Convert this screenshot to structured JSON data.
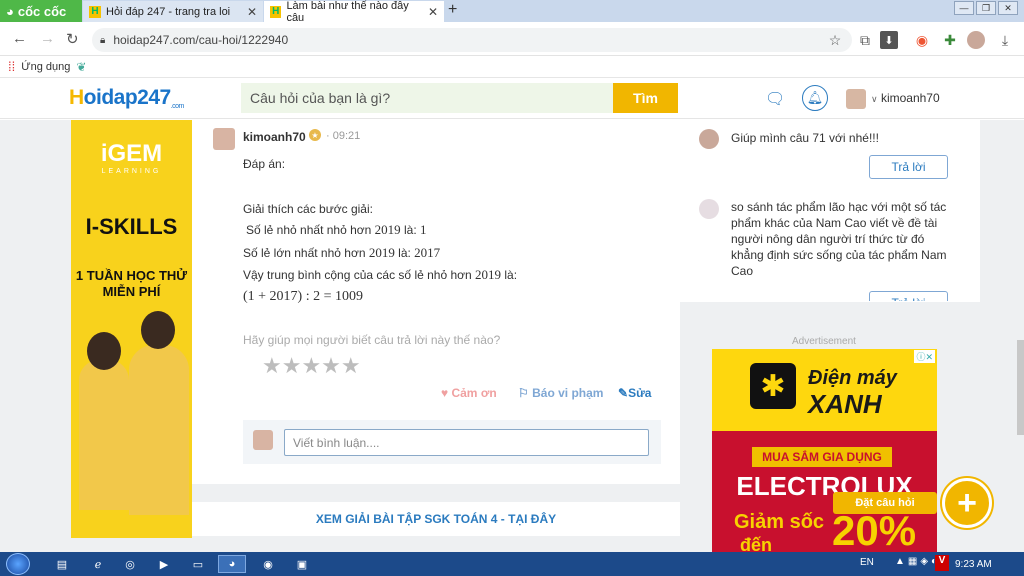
{
  "browser": {
    "brand": "cốc cốc",
    "tabs": [
      {
        "title": "Hỏi đáp 247 - trang tra loi"
      },
      {
        "title": "Làm bài như thế nào đây câu"
      }
    ],
    "url": "hoidap247.com/cau-hoi/1222940",
    "bookmarks": [
      {
        "label": "Ứng dụng"
      }
    ]
  },
  "site": {
    "logo_prefix": "H",
    "logo_rest": "oidap247",
    "logo_sub": ".com",
    "search_placeholder": "Câu hỏi của bạn là gì?",
    "search_button": "Tìm",
    "username": "kimoanh70"
  },
  "ad_left": {
    "brand": "iGEM",
    "brand_sub": "LEARNING",
    "headline": "I-SKILLS",
    "line1": "1 TUẦN HỌC THỬ",
    "line2": "MIỄN PHÍ"
  },
  "answer": {
    "user": "kimoanh70",
    "time": "· 09:21",
    "label": "Đáp án:",
    "explain_title": "Giải thích các bước giải:",
    "line1_text": "Số lẻ nhỏ nhất nhỏ hơn ",
    "line1_num": "2019",
    "line1_tail": " là: ",
    "line1_val": "1",
    "line2_text": "Số lẻ lớn nhất nhỏ hơn ",
    "line2_num": "2019",
    "line2_tail": " là: ",
    "line2_val": "2017",
    "line3_text": "Vậy trung bình cộng của các số lẻ nhỏ hơn ",
    "line3_num": "2019",
    "line3_tail": " là:",
    "formula": "(1 + 2017) : 2 = 1009",
    "rating_prompt": "Hãy giúp mọi người biết câu trả lời này thế nào?",
    "stars": "★★★★★",
    "rating_stars": 0,
    "thanks": "Cảm ơn",
    "report": "Báo vi phạm",
    "edit": "Sửa",
    "comment_placeholder": "Viết bình luận...."
  },
  "banner": "XEM GIẢI BÀI TẬP SGK TOÁN 4 - TẠI ĐÂY",
  "sidebar": {
    "questions": [
      {
        "text": "Giúp mình câu 71 với nhé!!!",
        "reply": "Trả lời"
      },
      {
        "text": "so sánh tác phẩm lão hạc với một số tác phẩm khác của Nam Cao viết về đề tài người nông dân người trí thức từ đó khẳng định sức sống của tác phẩm Nam Cao",
        "reply": "Trả lời"
      }
    ],
    "ad_label": "Advertisement"
  },
  "ad_right": {
    "brand_top": "Điện máy",
    "brand_main": "XANH",
    "tagline": "MUA SẮM GIA DỤNG",
    "product": "ELECTROLUX",
    "promo1": "Giảm sốc",
    "promo2": "đến",
    "percent": "20%"
  },
  "ask": {
    "label": "Đặt câu hỏi",
    "icon": "+"
  },
  "taskbar": {
    "lang": "EN",
    "time": "9:23 AM"
  },
  "colors": {
    "accent": "#f1b600",
    "link": "#2b7bbf",
    "tabbar": "#c9d8ec",
    "taskbar": "#1c4a8a"
  }
}
